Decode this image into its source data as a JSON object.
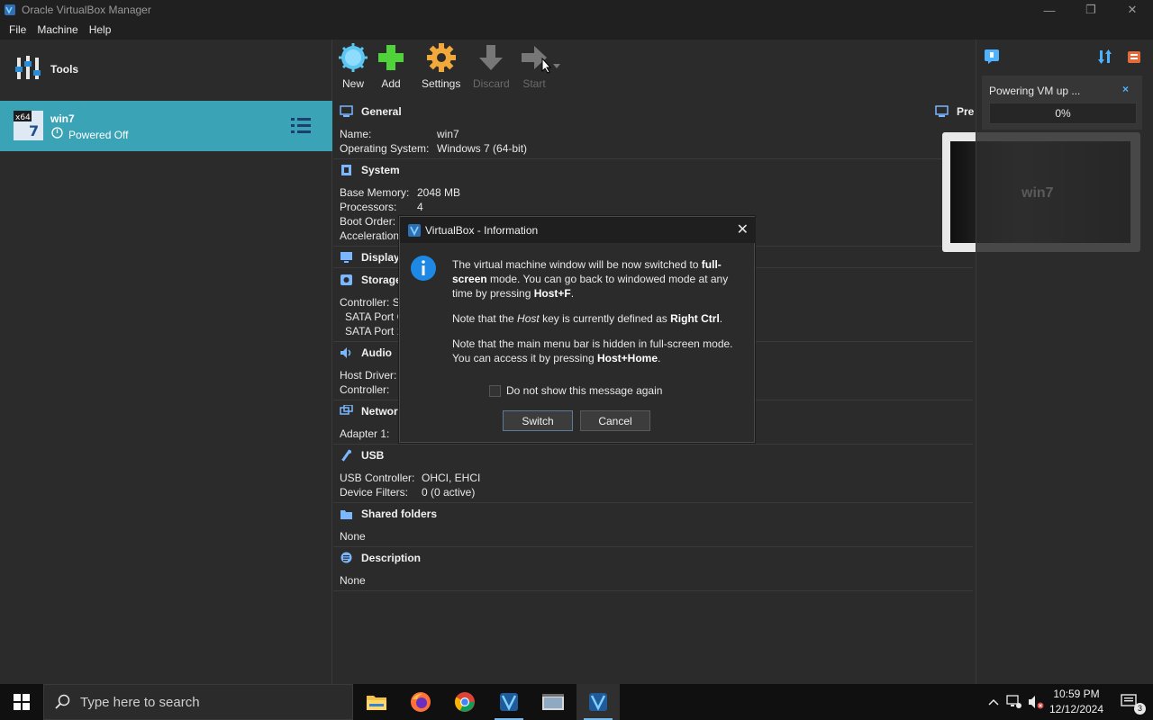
{
  "window": {
    "title": "Oracle VirtualBox Manager",
    "controls": [
      "—",
      "❐",
      "✕"
    ]
  },
  "menu": [
    "File",
    "Machine",
    "Help"
  ],
  "sidebar": {
    "tools_label": "Tools",
    "vm": {
      "name": "win7",
      "state": "Powered Off",
      "os_badge": "x64 7"
    }
  },
  "toolbar": {
    "new": "New",
    "add": "Add",
    "settings": "Settings",
    "discard": "Discard",
    "start": "Start"
  },
  "details": {
    "general": {
      "title": "General",
      "name_label": "Name:",
      "name_value": "win7",
      "os_label": "Operating System:",
      "os_value": "Windows 7 (64-bit)"
    },
    "system": {
      "title": "System",
      "memory_label": "Base Memory:",
      "memory_value": "2048 MB",
      "processors_label": "Processors:",
      "processors_value": "4",
      "boot_label": "Boot Order:",
      "accel_label": "Acceleration:"
    },
    "display": {
      "title": "Display"
    },
    "storage": {
      "title": "Storage",
      "controller_label": "Controller: S",
      "port0": "SATA Port C",
      "port1": "SATA Port 1"
    },
    "audio": {
      "title": "Audio",
      "driver_label": "Host Driver:",
      "controller_label": "Controller:"
    },
    "network": {
      "title": "Networ",
      "adapter_label": "Adapter 1:"
    },
    "usb": {
      "title": "USB",
      "controller_label": "USB Controller:",
      "controller_value": "OHCI, EHCI",
      "filters_label": "Device Filters:",
      "filters_value": "0 (0 active)"
    },
    "shared": {
      "title": "Shared folders",
      "value": "None"
    },
    "description": {
      "title": "Description",
      "value": "None"
    }
  },
  "preview": {
    "title": "Pre",
    "vm_name": "win7"
  },
  "notification": {
    "title": "Powering VM up ...",
    "close": "×",
    "progress_text": "0%",
    "progress": 0
  },
  "dialog": {
    "title": "VirtualBox - Information",
    "close": "✕",
    "p1_a": "The virtual machine window will be now switched to ",
    "p1_b": "full-screen",
    "p1_c": " mode. You can go back to windowed mode at any time by pressing ",
    "p1_d": "Host+F",
    "p1_e": ".",
    "p2_a": "Note that the ",
    "p2_b": "Host",
    "p2_c": " key is currently defined as ",
    "p2_d": "Right Ctrl",
    "p2_e": ".",
    "p3_a": "Note that the main menu bar is hidden in full-screen mode. You can access it by pressing ",
    "p3_b": "Host+Home",
    "p3_c": ".",
    "checkbox_label": "Do not show this message again",
    "switch": "Switch",
    "cancel": "Cancel"
  },
  "taskbar": {
    "search_placeholder": "Type here to search",
    "time": "10:59 PM",
    "date": "12/12/2024",
    "notifications_count": "3"
  },
  "colors": {
    "accent": "#3aa3b6",
    "info_blue": "#1e88e5"
  }
}
